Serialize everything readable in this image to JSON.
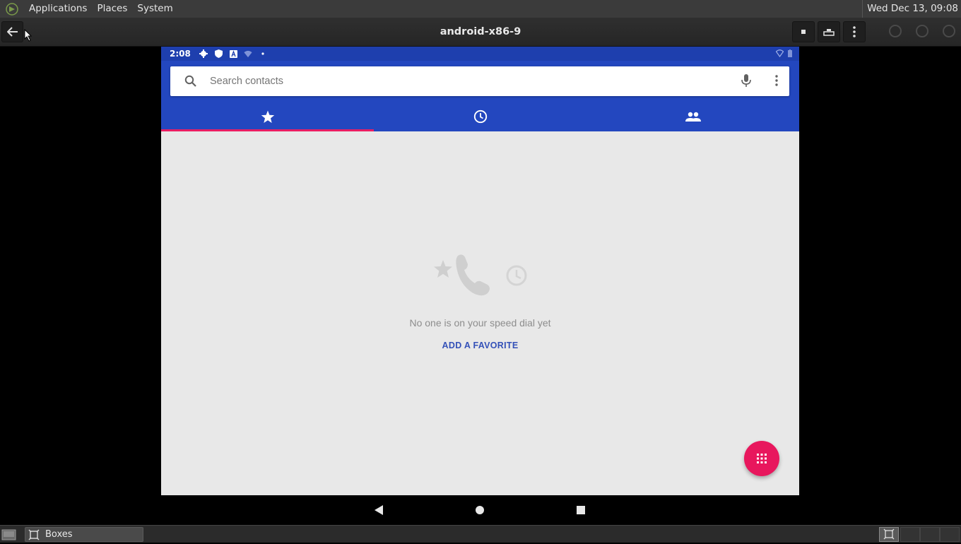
{
  "topbar": {
    "menus": [
      "Applications",
      "Places",
      "System"
    ],
    "clock": "Wed Dec 13, 09:08"
  },
  "window": {
    "title": "android-x86-9"
  },
  "android": {
    "status_time": "2:08",
    "search_placeholder": "Search contacts",
    "tabs": [
      {
        "icon": "star-icon",
        "active": true
      },
      {
        "icon": "clock-icon",
        "active": false
      },
      {
        "icon": "people-icon",
        "active": false
      }
    ],
    "empty_message": "No one is on your speed dial yet",
    "add_favorite": "ADD A FAVORITE",
    "colors": {
      "appbar": "#2347bf",
      "statusbar": "#1e3fae",
      "accent": "#e91e63",
      "fab": "#e8175d",
      "link": "#3451b8"
    }
  },
  "taskbar": {
    "items": [
      {
        "label": "Boxes",
        "icon": "boxes-icon"
      }
    ]
  }
}
